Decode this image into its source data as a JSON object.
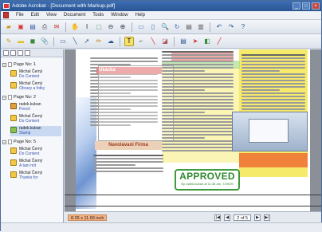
{
  "window": {
    "title": "Adobe Acrobat - [Document with Markup.pdf]",
    "minimize": "_",
    "maximize": "□",
    "close": "×"
  },
  "menu": [
    "File",
    "Edit",
    "View",
    "Document",
    "Tools",
    "Window",
    "Help"
  ],
  "comments_pane": {
    "nodes": [
      {
        "page": "Page No: 1",
        "expander": "−",
        "comments": [
          {
            "icon": "note-icon",
            "author": "Michal Černý",
            "type": "Do Content"
          },
          {
            "icon": "note-icon",
            "author": "Michal Černý",
            "type": "Obrazy a fotky"
          }
        ]
      },
      {
        "page": "Page No: 2",
        "expander": "−",
        "comments": [
          {
            "icon": "pencil-icon",
            "author": "radek.kuban",
            "type": "Pencil"
          },
          {
            "icon": "note-icon",
            "author": "Michal Černý",
            "type": "Do Content"
          },
          {
            "icon": "approved-icon",
            "author": "radek.kuban",
            "type": "Stamp"
          }
        ]
      },
      {
        "page": "Page No: 5",
        "expander": "−",
        "comments": [
          {
            "icon": "note-icon",
            "author": "Michal Černý",
            "type": "Do Content"
          },
          {
            "icon": "note-icon",
            "author": "Michal Černý",
            "type": "A tam mít"
          },
          {
            "icon": "note-icon",
            "author": "Michal Černý",
            "type": "Thanks for"
          }
        ]
      }
    ]
  },
  "document": {
    "red_heading": "Ukázka",
    "section_heading": "Navolavani Firma",
    "stamp_text": "APPROVED",
    "stamp_subtext": "By radek.kuban at 11:38 am, 7/29/09"
  },
  "statusbar": {
    "measure": "8.26 x 11.69 inch",
    "page_indicator": "2 of 5",
    "first": "|◀",
    "prev": "◀",
    "next": "▶",
    "last": "▶|"
  },
  "colors": {
    "accent": "#2a5593",
    "stamp_green": "#2f8a2f",
    "highlight_yellow": "#f6ea6a",
    "highlight_red": "#e57f7f"
  }
}
